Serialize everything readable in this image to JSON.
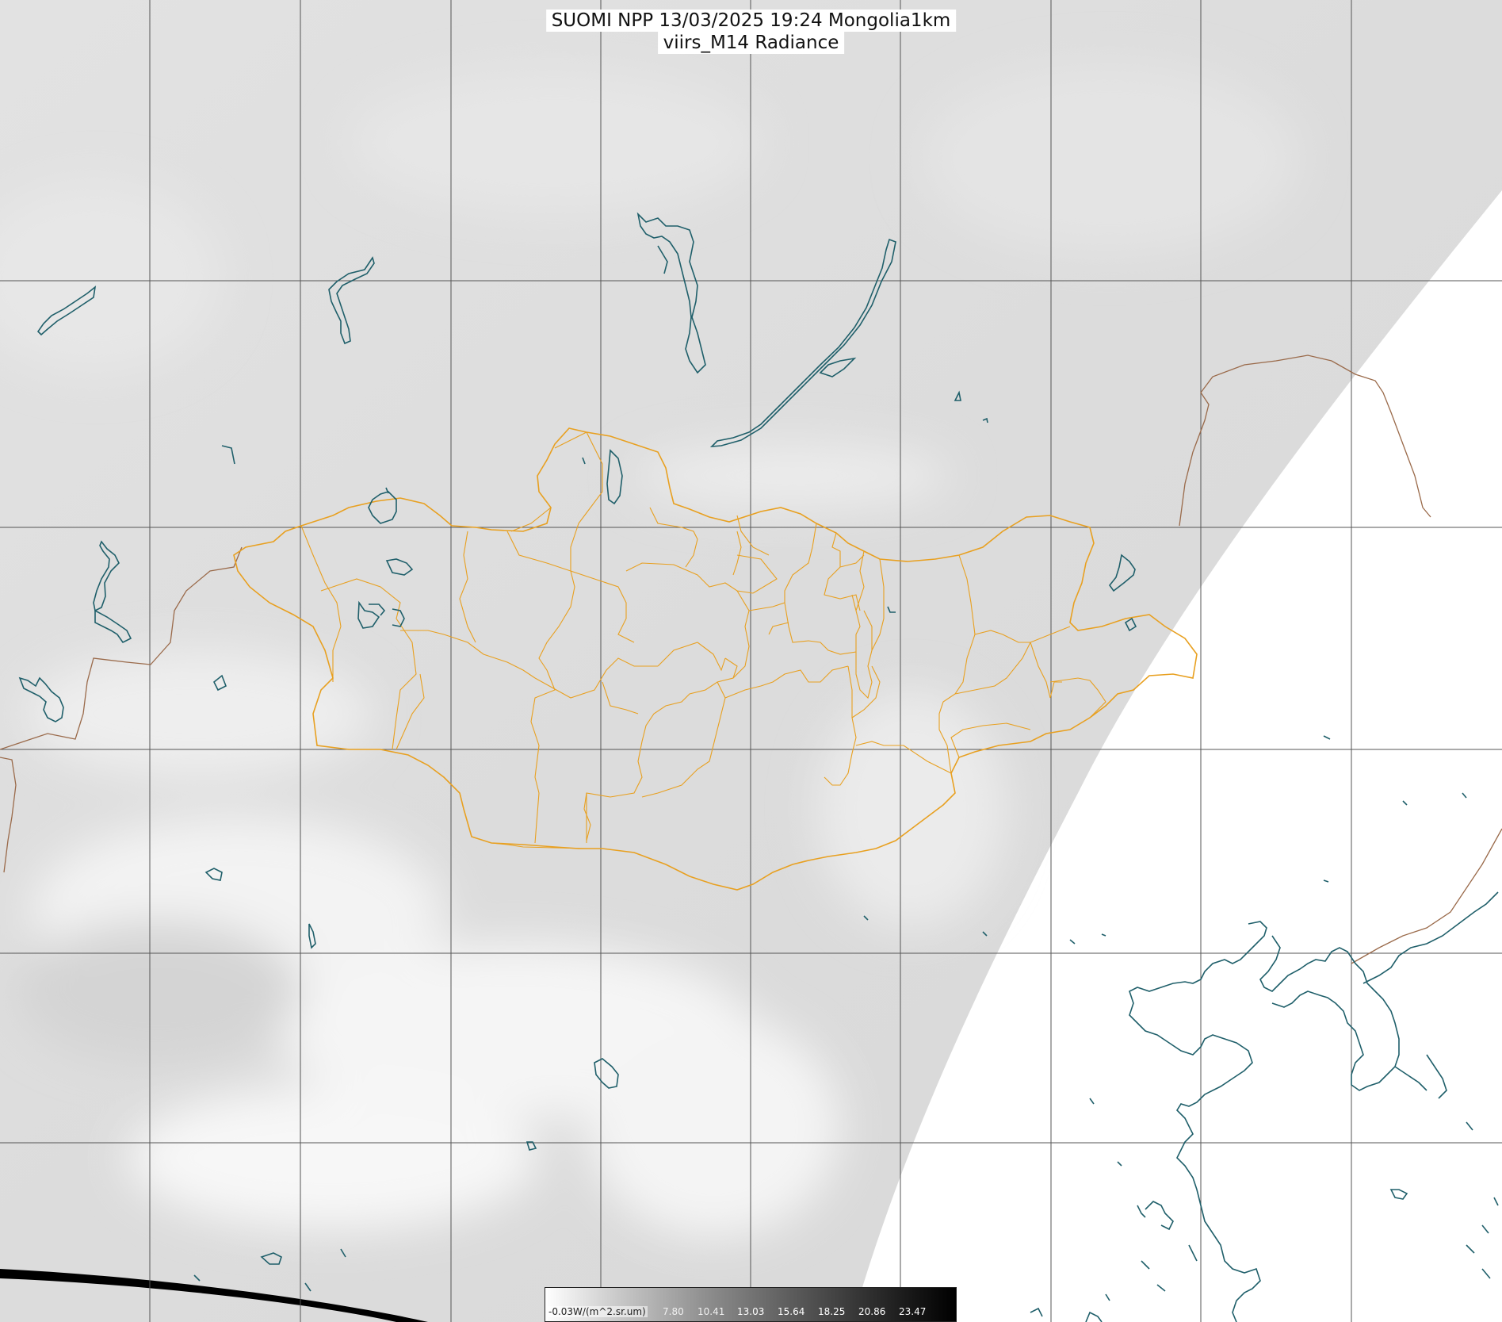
{
  "title": {
    "line1": "SUOMI NPP 13/03/2025 19:24 Mongolia1km",
    "line2": "viirs_M14 Radiance"
  },
  "colorbar": {
    "units_label": "-0.03W/(m^2.sr.um)",
    "ticks": [
      "7.80",
      "10.41",
      "13.03",
      "15.64",
      "18.25",
      "20.86",
      "23.47"
    ]
  },
  "colors": {
    "swath_gray": "#dedede",
    "no_data": "#ffffff",
    "grid": "#555555",
    "coastline_water": "#1f5f6a",
    "mongolia_borders": "#e8a020",
    "international_border": "#9a6a4a"
  }
}
